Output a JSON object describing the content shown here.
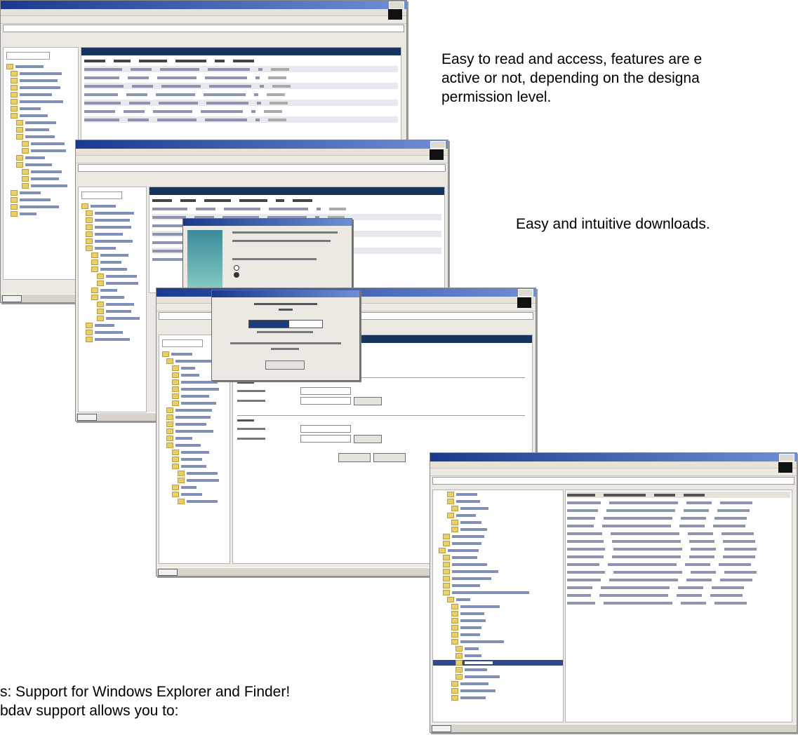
{
  "captions": {
    "access": [
      "Easy to read and access, features are e",
      "active or not, depending on the designa",
      "permission level."
    ],
    "downloads": "Easy and intuitive downloads.",
    "webdav": [
      "s:  Support for Windows Explorer and Finder!",
      "bdav support allows you to:"
    ]
  },
  "colors": {
    "title_gradient_start": "#1b3a8e",
    "title_gradient_end": "#6f8ed4",
    "nav_bar": "#17345f",
    "folder": "#e9cf6b"
  },
  "icons": [
    "folder-icon",
    "windows-logo-icon",
    "progress-bar"
  ],
  "download_dialog": {
    "progress": 0.55
  }
}
